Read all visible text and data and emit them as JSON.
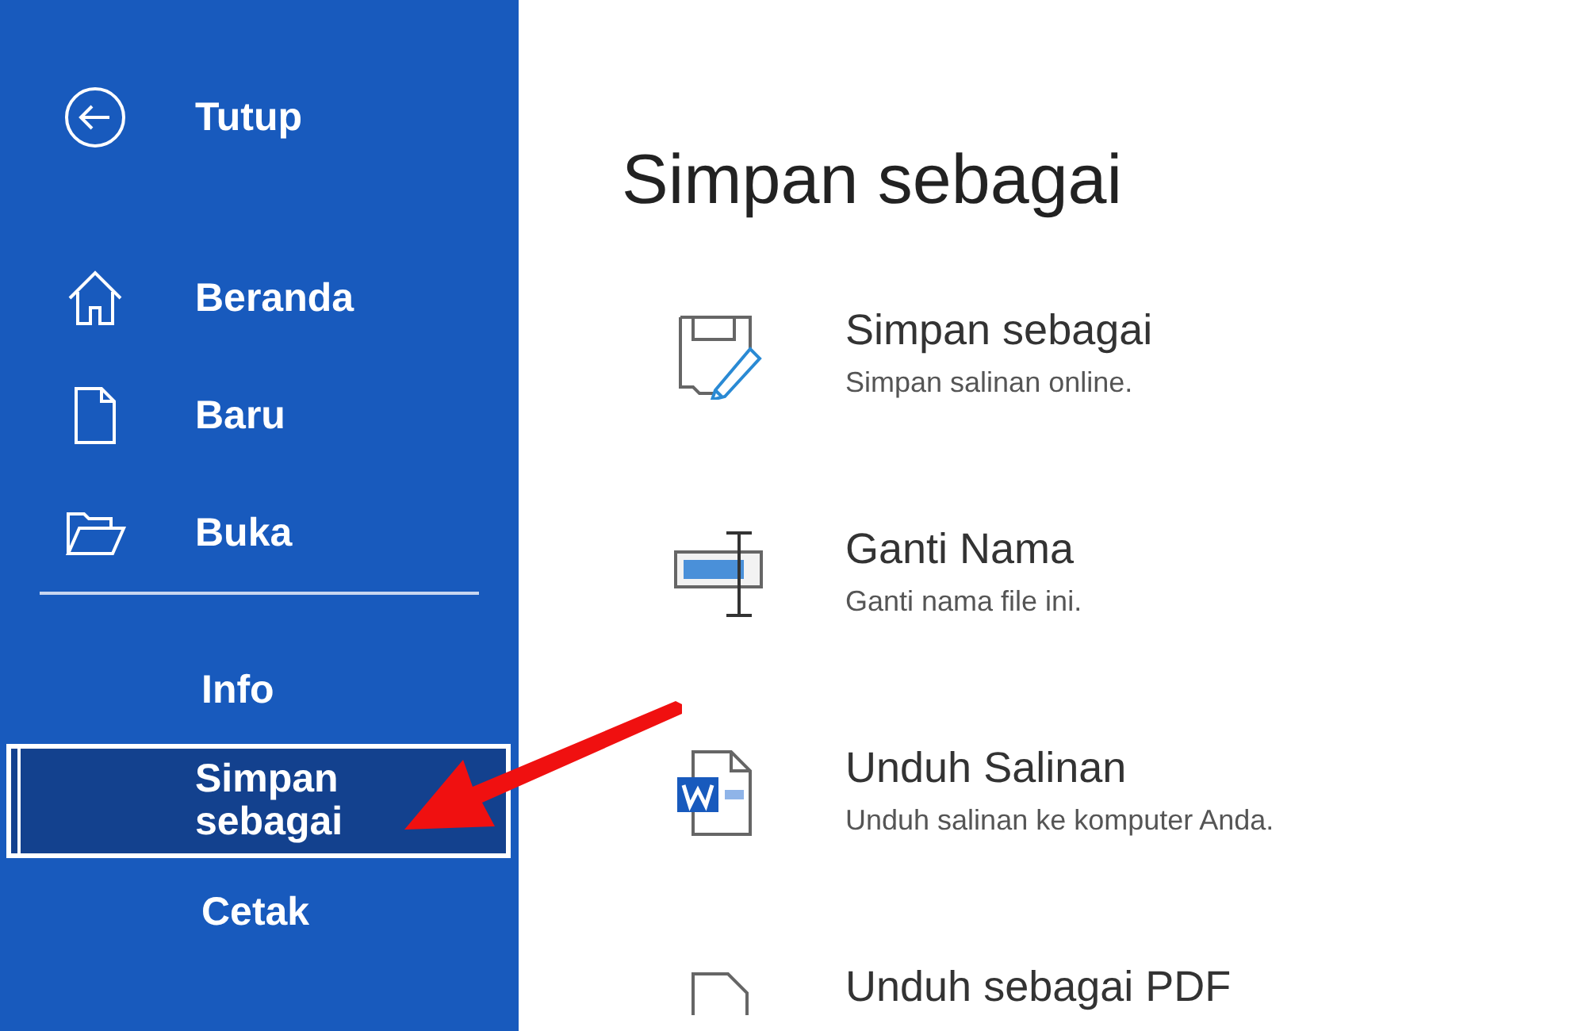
{
  "sidebar": {
    "back": {
      "label": "Tutup"
    },
    "top_items": [
      {
        "label": "Beranda"
      },
      {
        "label": "Baru"
      },
      {
        "label": "Buka"
      }
    ],
    "bottom_items": [
      {
        "label": "Info",
        "selected": false
      },
      {
        "label": "Simpan sebagai",
        "selected": true
      },
      {
        "label": "Cetak",
        "selected": false
      }
    ]
  },
  "main": {
    "title": "Simpan sebagai",
    "options": [
      {
        "title": "Simpan sebagai",
        "description": "Simpan salinan online."
      },
      {
        "title": "Ganti Nama",
        "description": "Ganti nama file ini."
      },
      {
        "title": "Unduh Salinan",
        "description": "Unduh salinan ke komputer Anda."
      },
      {
        "title": "Unduh sebagai PDF"
      }
    ]
  }
}
